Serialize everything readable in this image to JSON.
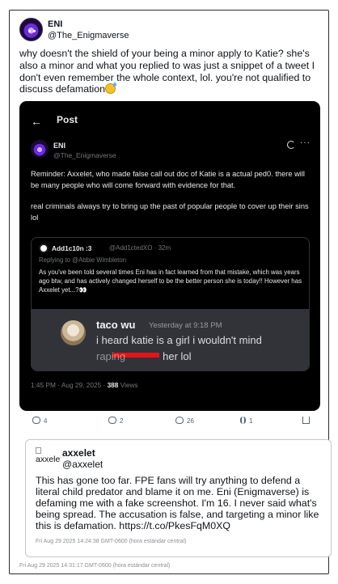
{
  "outer_tweet": {
    "name": "ENI",
    "handle": "@The_Enigmaverse",
    "text": "why doesn't the shield of your being a minor apply to Katie? she's also a minor and what you replied to was just a snippet of a tweet I don't even remember the whole context, lol. you're not qualified to discuss defamation",
    "emoji": "sweat-smile-emoji",
    "timestamp": "Fri Aug 29 2025 14:31:17 GMT-0600 (hora estándar central)"
  },
  "screenshot": {
    "header": {
      "back_icon": "back-arrow-icon",
      "title": "Post"
    },
    "author": {
      "name": "ENI",
      "handle": "@The_Enigmaverse"
    },
    "text_p1": "Reminder: Axxelet, who made false call out doc of Katie is a actual ped0. there will be many people who will come forward with evidence for that.",
    "text_p2": "real criminals always try to bring up the past of popular people to cover up their sins lol",
    "quote": {
      "name": "Add1c10n :3",
      "handle_time": "@Add1ctedXO · 32m",
      "reply_to": "Replying to @Abbie Wimbleton",
      "text": "As you've been told several times Eni has in fact learned from that mistake, which was years ago btw, and has actively changed herself to be the better person she is today!! However has Axxelet yet...?👀",
      "discord": {
        "username": "taco wu",
        "time": "Yesterday at 9:18 PM",
        "line1": "i heard katie is a girl i wouldn't mind",
        "line2_hidden": "raping",
        "line2": "her lol"
      }
    },
    "meta": {
      "time": "1:45 PM · Aug 29, 2025 · ",
      "views_count": "388",
      "views_label": " Views"
    }
  },
  "actions": {
    "replies": "4",
    "reposts": "2",
    "likes": "26",
    "views": "1"
  },
  "quoted_tweet": {
    "avatar_alt": "axxelet",
    "name": "axxelet",
    "handle": "@axxelet",
    "text": "This has gone too far. FPE fans will try anything to defend a literal child predator and blame it on me. Eni (Enigmaverse) is defaming me with a fake screenshot. I'm 16. I never said what's being spread. The accusation is false, and targeting a minor like this is defamation. https://t.co/PkesFqM0XQ",
    "timestamp": "Fri Aug 29 2025 14:24:38 GMT-0600 (hora estándar central)"
  }
}
